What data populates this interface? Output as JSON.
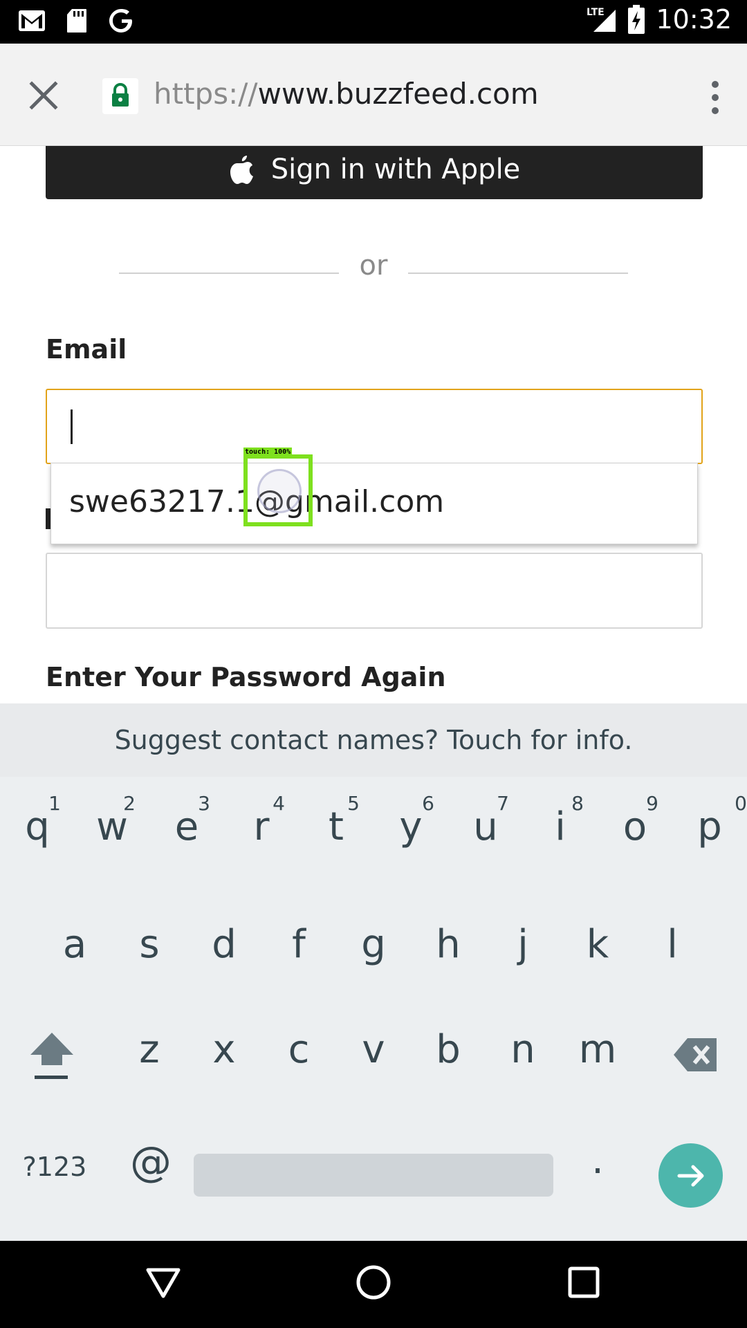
{
  "status_bar": {
    "time": "10:32",
    "network": "LTE",
    "icons": [
      "gmail-icon",
      "sd-card-icon",
      "google-icon",
      "signal-icon",
      "battery-charging-icon"
    ]
  },
  "browser": {
    "url_scheme": "https://",
    "url_host": "www.buzzfeed.com",
    "icons": [
      "close-icon",
      "lock-icon",
      "overflow-menu-icon"
    ]
  },
  "page": {
    "apple_button_label": "Sign in with Apple",
    "divider_text": "or",
    "email_label": "Email",
    "email_value": "",
    "password_again_label": "Enter Your Password Again"
  },
  "autofill": {
    "suggestion": "swe63217.1@gmail.com"
  },
  "touch_overlay": {
    "label": "touch: 100%",
    "color": "#7ee01e"
  },
  "keyboard": {
    "suggest_text": "Suggest contact names? Touch for info.",
    "row1": [
      {
        "ch": "q",
        "hint": "1"
      },
      {
        "ch": "w",
        "hint": "2"
      },
      {
        "ch": "e",
        "hint": "3"
      },
      {
        "ch": "r",
        "hint": "4"
      },
      {
        "ch": "t",
        "hint": "5"
      },
      {
        "ch": "y",
        "hint": "6"
      },
      {
        "ch": "u",
        "hint": "7"
      },
      {
        "ch": "i",
        "hint": "8"
      },
      {
        "ch": "o",
        "hint": "9"
      },
      {
        "ch": "p",
        "hint": "0"
      }
    ],
    "row2": [
      "a",
      "s",
      "d",
      "f",
      "g",
      "h",
      "j",
      "k",
      "l"
    ],
    "row3": [
      "z",
      "x",
      "c",
      "v",
      "b",
      "n",
      "m"
    ],
    "symbols_label": "?123",
    "at_label": "@",
    "period_label": ".",
    "accent_color": "#4db6ac"
  },
  "nav_bar": {
    "icons": [
      "back-icon",
      "home-icon",
      "recents-icon"
    ]
  }
}
